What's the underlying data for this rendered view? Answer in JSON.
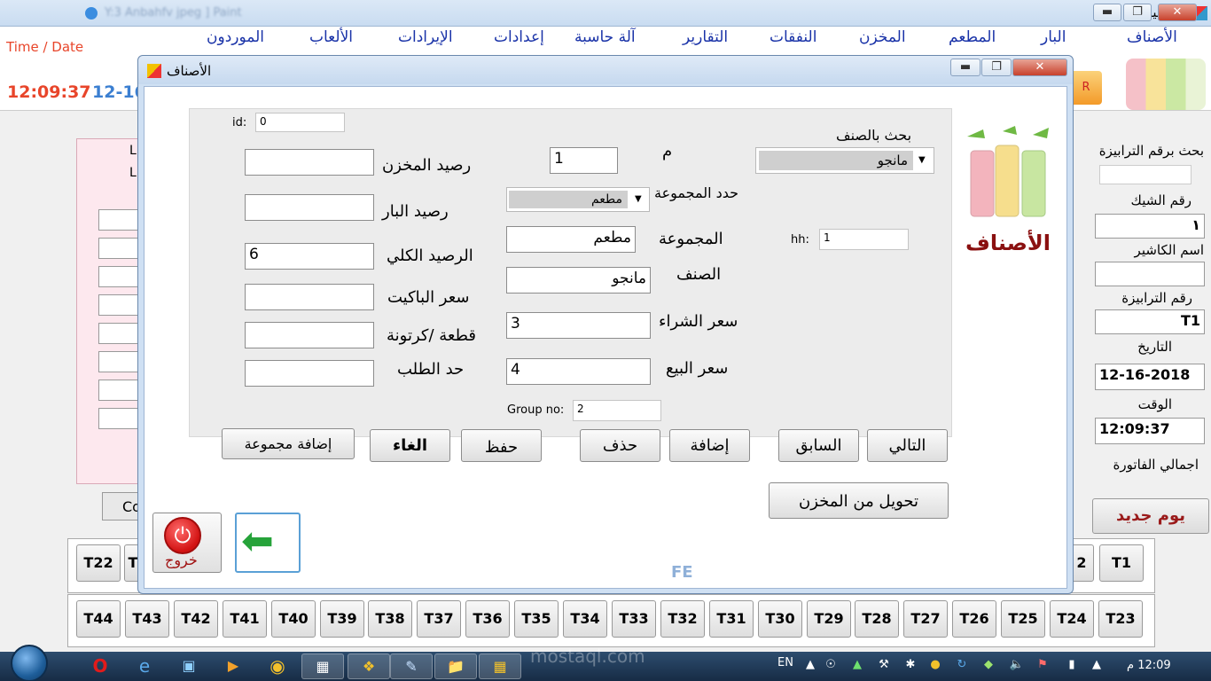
{
  "main": {
    "title": "الرئيسية",
    "blurred_title": "Y:3 Anbahfv jpeg ] Paint",
    "time_date_label": "Time / Date",
    "clock_time": "12:09:37",
    "clock_date": "12-16",
    "left_button_label": "Co",
    "menu": [
      {
        "id": "items",
        "label": "الأصناف"
      },
      {
        "id": "bar",
        "label": "البار"
      },
      {
        "id": "restaurant",
        "label": "المطعم"
      },
      {
        "id": "store",
        "label": "المخزن"
      },
      {
        "id": "expenses",
        "label": "النفقات"
      },
      {
        "id": "reports",
        "label": "التقارير"
      },
      {
        "id": "calculator",
        "label": "آلة حاسبة"
      },
      {
        "id": "settings",
        "label": "إعدادات"
      },
      {
        "id": "revenues",
        "label": "الإيرادات"
      },
      {
        "id": "games",
        "label": "الألعاب"
      },
      {
        "id": "suppliers",
        "label": "الموردون"
      }
    ],
    "sidebar": {
      "search_table_label": "بحث برقم الترابيزة",
      "search_table_value": "",
      "check_no_label": "رقم الشيك",
      "check_no_value": "١",
      "cashier_label": "اسم الكاشير",
      "cashier_value": "",
      "table_no_label": "رقم الترابيزة",
      "table_no_value": "T1",
      "date_label": "التاريخ",
      "date_value": "12-16-2018",
      "time_label": "الوقت",
      "time_value": "12:09:37",
      "invoice_total_label": "اجمالي الفاتورة",
      "new_day_label": "يوم جديد"
    },
    "tables_row1": [
      "T22",
      "T",
      "2",
      "T1"
    ],
    "tables_row2": [
      "T44",
      "T43",
      "T42",
      "T41",
      "T40",
      "T39",
      "T38",
      "T37",
      "T36",
      "T35",
      "T34",
      "T33",
      "T32",
      "T31",
      "T30",
      "T29",
      "T28",
      "T27",
      "T26",
      "T25",
      "T24",
      "T23"
    ]
  },
  "dialog": {
    "title": "الأصناف",
    "logo_label": "الأصناف",
    "footer_mark": "FE",
    "fields": {
      "id_label": "id:",
      "id_value": "0",
      "search_item_label": "بحث بالصنف",
      "search_item_value": "مانجو",
      "m_label": "م",
      "m_value": "1",
      "select_group_label": "حدد المجموعة",
      "select_group_value": "مطعم",
      "group_label": "المجموعة",
      "group_value": "مطعم",
      "hh_label": "hh:",
      "hh_value": "1",
      "item_label": "الصنف",
      "item_value": "مانجو",
      "buy_price_label": "سعر الشراء",
      "buy_price_value": "3",
      "sell_price_label": "سعر البيع",
      "sell_price_value": "4",
      "group_no_label": "Group no:",
      "group_no_value": "2",
      "store_balance_label": "رصيد المخزن",
      "store_balance_value": "",
      "bar_balance_label": "رصيد البار",
      "bar_balance_value": "",
      "total_balance_label": "الرصيد الكلي",
      "total_balance_value": "6",
      "packet_price_label": "سعر الباكيت",
      "packet_price_value": "",
      "piece_carton_label": "قطعة /كرتونة",
      "piece_carton_value": "",
      "order_limit_label": "حد الطلب",
      "order_limit_value": ""
    },
    "buttons": {
      "next": "التالي",
      "previous": "السابق",
      "add": "إضافة",
      "delete": "حذف",
      "save": "حفظ",
      "cancel": "الغاء",
      "add_group": "إضافة مجموعة",
      "transfer_from_store": "تحويل من المخزن",
      "exit": "خروج"
    }
  },
  "taskbar": {
    "lang": "EN",
    "time": "12:09 م",
    "watermark": "mostaql.com"
  }
}
